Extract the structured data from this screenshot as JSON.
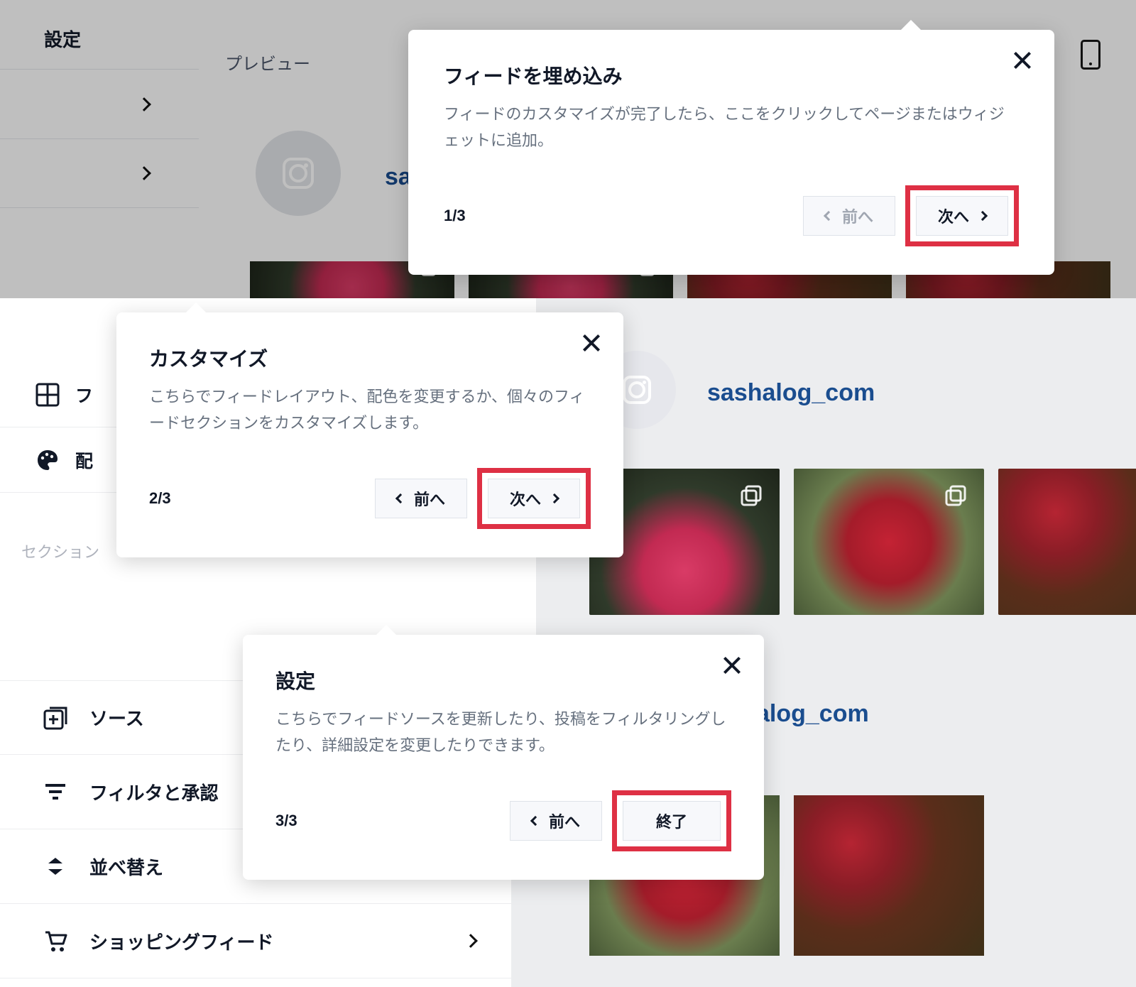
{
  "panel1": {
    "sidebar_title": "設定",
    "preview_label": "プレビュー",
    "username_truncated": "sas",
    "popover": {
      "title": "フィードを埋め込み",
      "desc": "フィードのカスタマイズが完了したら、ここをクリックしてページまたはウィジェットに追加。",
      "step": "1/3",
      "prev": "前へ",
      "next": "次へ"
    }
  },
  "panel2": {
    "sidebar": {
      "item1": "フ",
      "item2": "配",
      "section_label": "セクション"
    },
    "username": "sashalog_com",
    "popover": {
      "title": "カスタマイズ",
      "desc": "こちらでフィードレイアウト、配色を変更するか、個々のフィードセクションをカスタマイズします。",
      "step": "2/3",
      "prev": "前へ",
      "next": "次へ"
    }
  },
  "panel3": {
    "sidebar": {
      "sources": "ソース",
      "filters": "フィルタと承認",
      "sort": "並べ替え",
      "shopping": "ショッピングフィード"
    },
    "username_truncated": "alog_com",
    "popover": {
      "title": "設定",
      "desc": "こちらでフィードソースを更新したり、投稿をフィルタリングしたり、詳細設定を変更したりできます。",
      "step": "3/3",
      "prev": "前へ",
      "finish": "終了"
    }
  }
}
